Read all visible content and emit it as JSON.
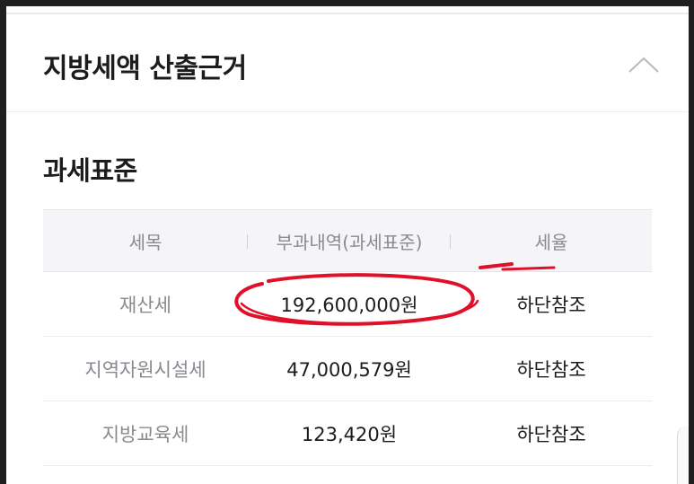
{
  "header": {
    "title": "지방세액 산출근거",
    "collapse_icon": "chevron-up-icon"
  },
  "section": {
    "title": "과세표준"
  },
  "table": {
    "columns": [
      "세목",
      "부과내역(과세표준)",
      "세율"
    ],
    "rows": [
      {
        "item": "재산세",
        "amount": "192,600,000원",
        "rate": "하단참조"
      },
      {
        "item": "지역자원시설세",
        "amount": "47,000,579원",
        "rate": "하단참조"
      },
      {
        "item": "지방교육세",
        "amount": "123,420원",
        "rate": "하단참조"
      }
    ]
  },
  "colors": {
    "annotation": "#e0102a",
    "header_bg": "#f5f5f8",
    "muted_text": "#8a8a90"
  }
}
